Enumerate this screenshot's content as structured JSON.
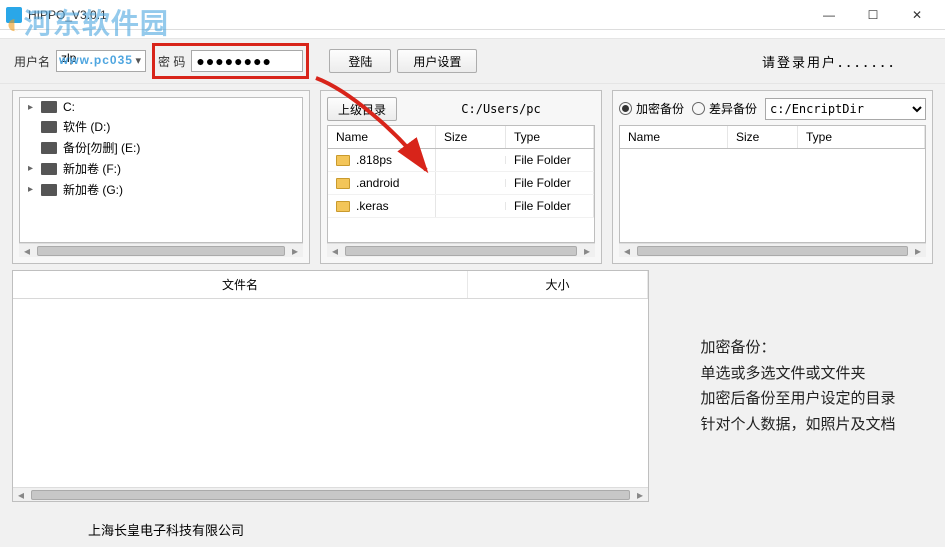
{
  "titlebar": {
    "title": "HIPPO_V3.0.1"
  },
  "watermark": {
    "text": "河东软件园"
  },
  "toolbar": {
    "user_label": "用户名",
    "user_value": "zlp",
    "pcsite_overlay": "www.pc035",
    "pwd_label": "密  码",
    "pwd_value": "●●●●●●●●",
    "login_btn": "登陆",
    "settings_btn": "用户设置",
    "login_prompt": "请登录用户．．．．．．．"
  },
  "tree": {
    "items": [
      {
        "exp": "▸",
        "label": "C:"
      },
      {
        "exp": "",
        "label": "软件 (D:)"
      },
      {
        "exp": "",
        "label": "备份[勿删] (E:)"
      },
      {
        "exp": "▸",
        "label": "新加卷 (F:)"
      },
      {
        "exp": "▸",
        "label": "新加卷 (G:)"
      }
    ]
  },
  "mid": {
    "up_btn": "上级目录",
    "path": "C:/Users/pc",
    "cols": {
      "name": "Name",
      "size": "Size",
      "type": "Type"
    },
    "rows": [
      {
        "name": ".818ps",
        "size": "",
        "type": "File Folder"
      },
      {
        "name": ".android",
        "size": "",
        "type": "File Folder"
      },
      {
        "name": ".keras",
        "size": "",
        "type": "File Folder"
      }
    ]
  },
  "right": {
    "radio_a": "加密备份",
    "radio_b": "差异备份",
    "dest_value": "c:/EncriptDir",
    "cols": {
      "name": "Name",
      "size": "Size",
      "type": "Type"
    }
  },
  "lower": {
    "col_filename": "文件名",
    "col_size": "大小",
    "help_title": "加密备份：",
    "help_line1": "单选或多选文件或文件夹",
    "help_line2": "加密后备份至用户设定的目录",
    "help_line3": "针对个人数据，如照片及文档"
  },
  "footer": {
    "company": "上海长皇电子科技有限公司"
  }
}
